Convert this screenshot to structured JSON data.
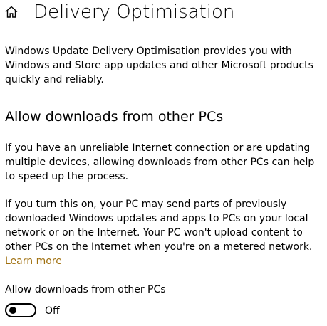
{
  "header": {
    "title": "Delivery Optimisation",
    "home_icon": "home-icon"
  },
  "intro_text": "Windows Update Delivery Optimisation provides you with Windows and Store app updates and other Microsoft products quickly and reliably.",
  "section": {
    "heading": "Allow downloads from other PCs",
    "paragraph1": "If you have an unreliable Internet connection or are updating multiple devices, allowing downloads from other PCs can help to speed up the process.",
    "paragraph2": "If you turn this on, your PC may send parts of previously downloaded Windows updates and apps to PCs on your local network or on the Internet. Your PC won't upload content to other PCs on the Internet when you're on a metered network.",
    "learn_more": "Learn more",
    "link_color": "#a0700f"
  },
  "toggle": {
    "label": "Allow downloads from other PCs",
    "state_text": "Off",
    "on": false
  }
}
